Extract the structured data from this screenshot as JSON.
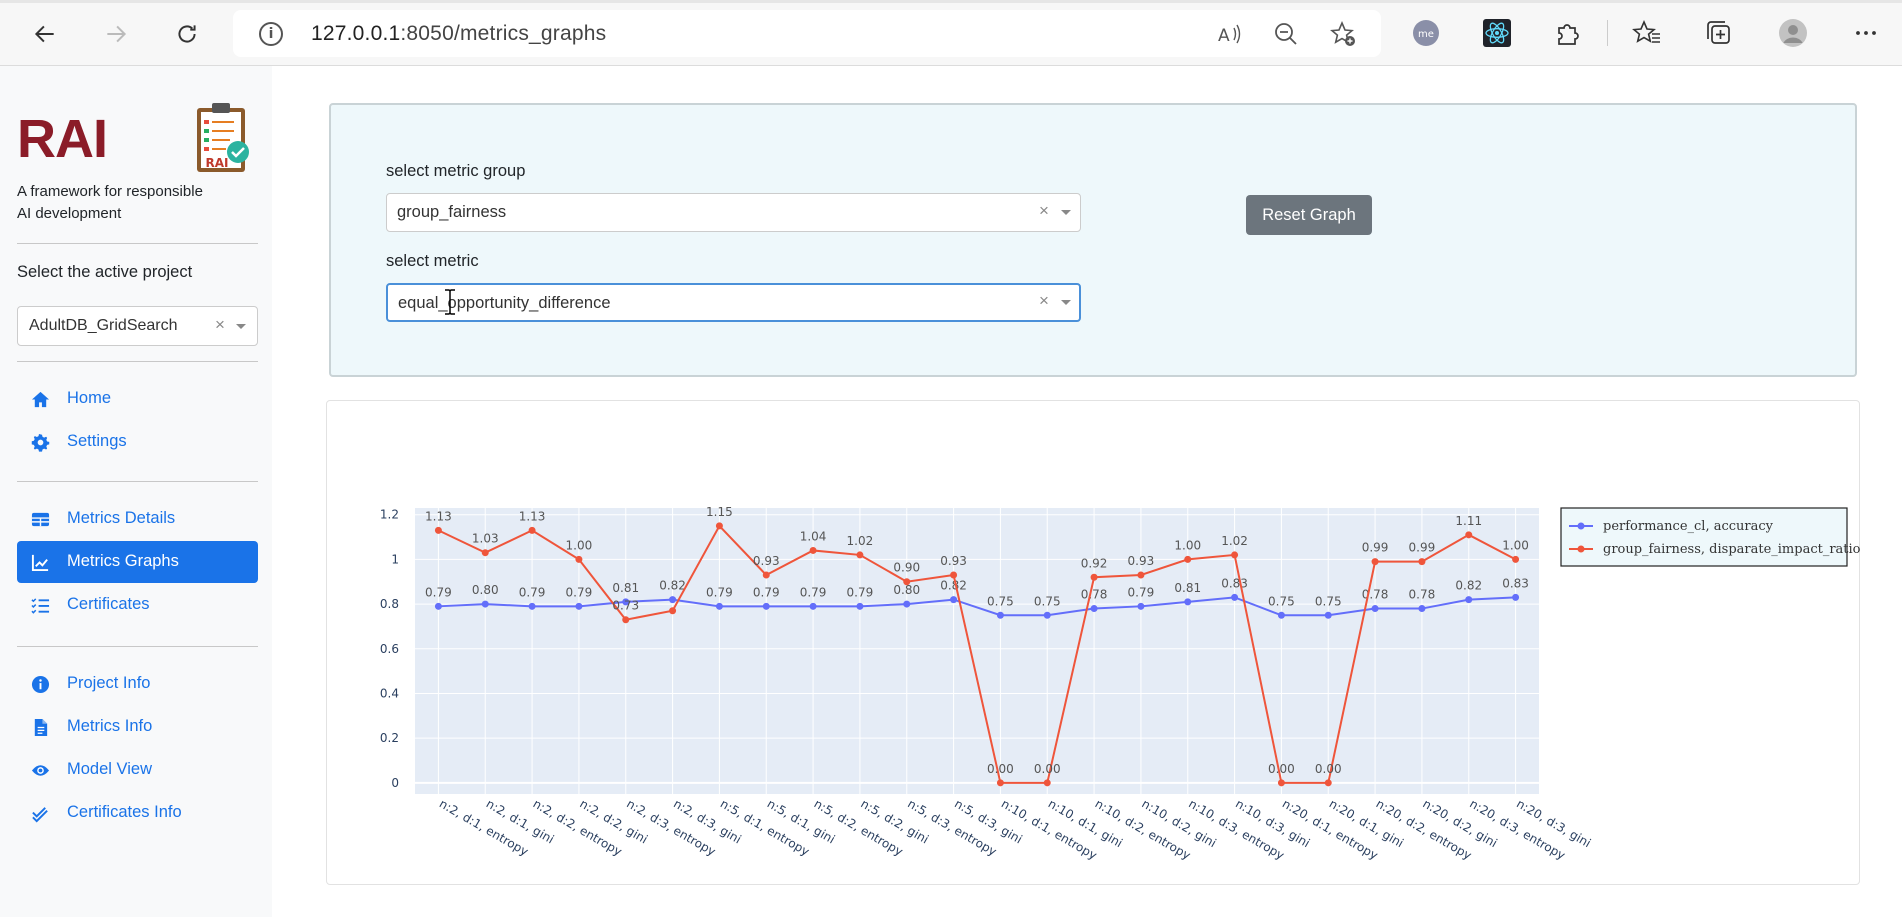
{
  "browser": {
    "url_host": "127.0.0.1",
    "url_path": ":8050/metrics_graphs",
    "icons": [
      "back-arrow-icon",
      "forward-arrow-icon",
      "refresh-icon",
      "info-icon",
      "read-aloud-icon",
      "zoom-out-icon",
      "favorite-add-icon",
      "me-extension-icon",
      "react-extension-icon",
      "extensions-puzzle-icon",
      "favorites-icon",
      "collections-icon",
      "profile-avatar-icon",
      "more-menu-icon"
    ]
  },
  "sidebar": {
    "logo_text": "RAI",
    "logo_image_caption": "RAI",
    "tagline": "A framework for responsible AI development",
    "project_label": "Select the active project",
    "project_value": "AdultDB_GridSearch",
    "nav_top": [
      {
        "label": "Home",
        "icon": "home-icon"
      },
      {
        "label": "Settings",
        "icon": "gear-icon"
      }
    ],
    "nav_mid": [
      {
        "label": "Metrics Details",
        "icon": "table-icon"
      },
      {
        "label": "Metrics Graphs",
        "icon": "chart-icon",
        "active": true
      },
      {
        "label": "Certificates",
        "icon": "list-check-icon"
      }
    ],
    "nav_bottom": [
      {
        "label": "Project Info",
        "icon": "info-circle-icon"
      },
      {
        "label": "Metrics Info",
        "icon": "file-icon"
      },
      {
        "label": "Model View",
        "icon": "eye-icon"
      },
      {
        "label": "Certificates Info",
        "icon": "double-check-icon"
      }
    ],
    "active_color": "#1a73e8"
  },
  "filters": {
    "group_label": "select metric group",
    "group_value": "group_fairness",
    "metric_label": "select metric",
    "metric_value": "equal_opportunity_difference",
    "reset_label": "Reset Graph"
  },
  "chart_data": {
    "type": "line",
    "categories": [
      "n:2, d:1, entropy",
      "n:2, d:1, gini",
      "n:2, d:2, entropy",
      "n:2, d:2, gini",
      "n:2, d:3, entropy",
      "n:2, d:3, gini",
      "n:5, d:1, entropy",
      "n:5, d:1, gini",
      "n:5, d:2, entropy",
      "n:5, d:2, gini",
      "n:5, d:3, entropy",
      "n:5, d:3, gini",
      "n:10, d:1, entropy",
      "n:10, d:1, gini",
      "n:10, d:2, entropy",
      "n:10, d:2, gini",
      "n:10, d:3, entropy",
      "n:10, d:3, gini",
      "n:20, d:1, entropy",
      "n:20, d:1, gini",
      "n:20, d:2, entropy",
      "n:20, d:2, gini",
      "n:20, d:3, entropy",
      "n:20, d:3, gini"
    ],
    "series": [
      {
        "name": "performance_cl, accuracy",
        "color": "#636efa",
        "values": [
          0.79,
          0.8,
          0.79,
          0.79,
          0.81,
          0.82,
          0.79,
          0.79,
          0.79,
          0.79,
          0.8,
          0.82,
          0.75,
          0.75,
          0.78,
          0.79,
          0.81,
          0.83,
          0.75,
          0.75,
          0.78,
          0.78,
          0.82,
          0.83
        ]
      },
      {
        "name": "group_fairness, disparate_impact_ratio",
        "color": "#ef553b",
        "values": [
          1.13,
          1.03,
          1.13,
          1.0,
          0.73,
          0.77,
          1.15,
          0.93,
          1.04,
          1.02,
          0.9,
          0.93,
          0.0,
          0.0,
          0.92,
          0.93,
          1.0,
          1.02,
          0.0,
          0.0,
          0.99,
          0.99,
          1.11,
          1.0
        ]
      }
    ],
    "data_labels": [
      [
        "0.79",
        "0.80",
        "0.79",
        "0.79",
        "0.81",
        "0.82",
        "0.79",
        "0.79",
        "0.79",
        "0.79",
        "0.80",
        "0.82",
        "0.75",
        "0.75",
        "0.78",
        "0.79",
        "0.81",
        "0.83",
        "0.75",
        "0.75",
        "0.78",
        "0.78",
        "0.82",
        "0.83"
      ],
      [
        "1.13",
        "1.03",
        "1.13",
        "1.00",
        "0.73",
        "",
        "1.15",
        "0.93",
        "1.04",
        "1.02",
        "0.90",
        "0.93",
        "0.00",
        "0.00",
        "0.92",
        "0.93",
        "1.00",
        "1.02",
        "0.00",
        "0.00",
        "0.99",
        "0.99",
        "1.11",
        "1.00"
      ]
    ],
    "yticks": [
      "0",
      "0.2",
      "0.4",
      "0.6",
      "0.8",
      "1",
      "1.2"
    ],
    "ylim": [
      -0.05,
      1.23
    ],
    "grid": true,
    "legend_position": "right",
    "plot_bg": "#e5ecf6"
  }
}
